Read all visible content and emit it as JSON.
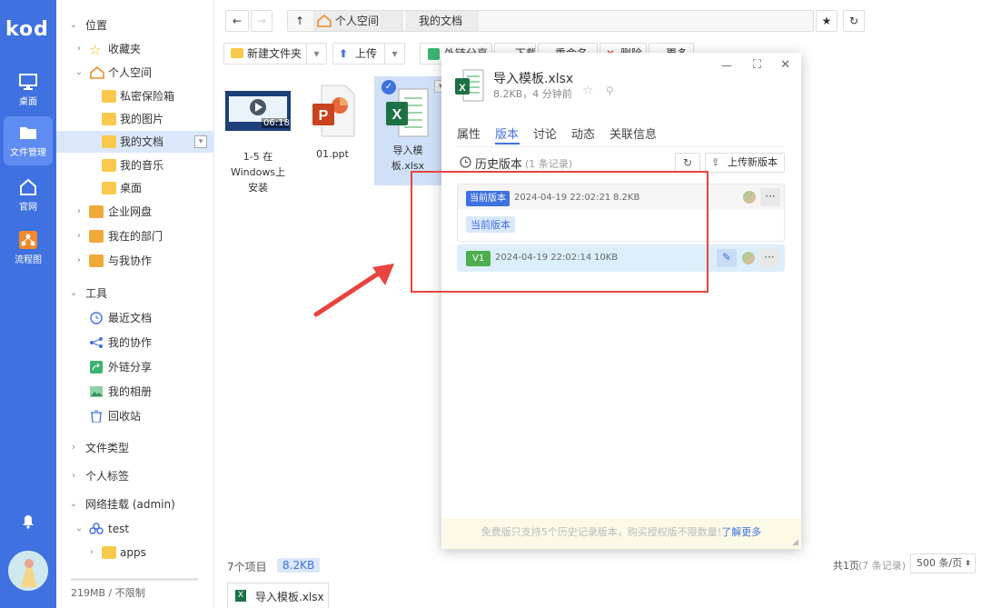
{
  "rail": {
    "logo": "kod",
    "items": [
      {
        "label": "桌面",
        "icon": "monitor-icon"
      },
      {
        "label": "文件管理",
        "icon": "folder-icon"
      },
      {
        "label": "官网",
        "icon": "home-icon"
      },
      {
        "label": "流程图",
        "icon": "flow-icon"
      }
    ]
  },
  "tree": {
    "location_header": "位置",
    "favorites": "收藏夹",
    "personal_space": "个人空间",
    "private_vault": "私密保险箱",
    "my_pictures": "我的图片",
    "my_documents": "我的文档",
    "my_music": "我的音乐",
    "desktop": "桌面",
    "enterprise_disk": "企业网盘",
    "my_department": "我在的部门",
    "collab_with_me": "与我协作",
    "tools_header": "工具",
    "recent_docs": "最近文档",
    "my_collab": "我的协作",
    "external_share": "外链分享",
    "my_album": "我的相册",
    "recycle_bin": "回收站",
    "file_types": "文件类型",
    "personal_tags": "个人标签",
    "network_mount": "网络挂载 (admin)",
    "test": "test",
    "apps": "apps",
    "usage": "219MB / 不限制"
  },
  "address": {
    "crumb1": "个人空间",
    "crumb2": "我的文档"
  },
  "toolbar": {
    "new_folder": "新建文件夹",
    "upload": "上传",
    "external_share": "外链分享",
    "download": "下载",
    "rename": "重命名",
    "delete": "删除",
    "more": "更多"
  },
  "files": [
    {
      "name": "1-5 在Windows上安装",
      "duration": "06:18"
    },
    {
      "name": "01.ppt"
    },
    {
      "name": "导入模板.xlsx"
    }
  ],
  "status": {
    "count": "7个项目",
    "size": "8.2KB",
    "pages": "共1页",
    "records": "(7 条记录)",
    "per_page": "500 条/页"
  },
  "taskbar": {
    "file": "导入模板.xlsx"
  },
  "panel": {
    "filename": "导入模板.xlsx",
    "meta": "8.2KB，4 分钟前",
    "tabs": [
      "属性",
      "版本",
      "讨论",
      "动态",
      "关联信息"
    ],
    "history_label": "历史版本",
    "history_count": "(1 条记录)",
    "upload_new": "上传新版本",
    "current": {
      "tag": "当前版本",
      "time": "2024-04-19 22:02:21",
      "size": "8.2KB",
      "badge": "当前版本"
    },
    "v1": {
      "tag": "V1",
      "time": "2024-04-19 22:02:14",
      "size": "10KB"
    },
    "footer_text": "免费版只支持5个历史记录版本，购买授权版不限数量!",
    "footer_link": "了解更多"
  },
  "colors": {
    "accent": "#3f71e0",
    "rail": "#3f71e0",
    "annotation": "#e8433f",
    "version_green": "#4cae4c"
  }
}
